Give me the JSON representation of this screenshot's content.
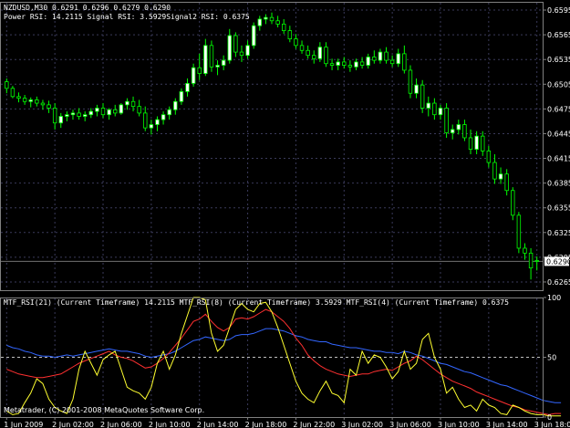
{
  "chart_data": [
    {
      "type": "candlestick",
      "symbol_line": "NZDUSD,M30  0.6291 0.6296 0.6279 0.6290",
      "indicator_line": "Power RSI: 14.2115 Signal RSI: 3.5929Signal2 RSI: 0.6375",
      "last_price_label": "0.6290",
      "last_price": 0.629,
      "ylim": [
        0.6255,
        0.6605
      ],
      "y_ticks": [
        "0.6595",
        "0.6565",
        "0.6535",
        "0.6505",
        "0.6475",
        "0.6445",
        "0.6415",
        "0.6385",
        "0.6355",
        "0.6325",
        "0.6295",
        "0.6265"
      ],
      "grid": true,
      "colors": {
        "bull": "#ffffff",
        "bear": "#000000",
        "wick": "#00ff00",
        "grid": "#3a3a5a",
        "last_price_line": "#707070"
      },
      "candles": [
        {
          "o": 0.6508,
          "h": 0.6512,
          "l": 0.6494,
          "c": 0.65
        },
        {
          "o": 0.65,
          "h": 0.6503,
          "l": 0.6488,
          "c": 0.649
        },
        {
          "o": 0.649,
          "h": 0.6495,
          "l": 0.6483,
          "c": 0.6488
        },
        {
          "o": 0.6488,
          "h": 0.6492,
          "l": 0.648,
          "c": 0.6484
        },
        {
          "o": 0.6484,
          "h": 0.6489,
          "l": 0.6477,
          "c": 0.6486
        },
        {
          "o": 0.6486,
          "h": 0.649,
          "l": 0.6478,
          "c": 0.6482
        },
        {
          "o": 0.6482,
          "h": 0.6486,
          "l": 0.6474,
          "c": 0.648
        },
        {
          "o": 0.648,
          "h": 0.6485,
          "l": 0.647,
          "c": 0.6476
        },
        {
          "o": 0.6476,
          "h": 0.6482,
          "l": 0.645,
          "c": 0.6458
        },
        {
          "o": 0.6458,
          "h": 0.647,
          "l": 0.6452,
          "c": 0.6466
        },
        {
          "o": 0.6466,
          "h": 0.6472,
          "l": 0.646,
          "c": 0.6468
        },
        {
          "o": 0.6468,
          "h": 0.6474,
          "l": 0.6462,
          "c": 0.647
        },
        {
          "o": 0.647,
          "h": 0.6476,
          "l": 0.6462,
          "c": 0.6466
        },
        {
          "o": 0.6466,
          "h": 0.6472,
          "l": 0.646,
          "c": 0.6468
        },
        {
          "o": 0.6468,
          "h": 0.6476,
          "l": 0.6464,
          "c": 0.6472
        },
        {
          "o": 0.6472,
          "h": 0.648,
          "l": 0.6466,
          "c": 0.6476
        },
        {
          "o": 0.6476,
          "h": 0.6482,
          "l": 0.6464,
          "c": 0.6468
        },
        {
          "o": 0.6468,
          "h": 0.6476,
          "l": 0.6462,
          "c": 0.6474
        },
        {
          "o": 0.6474,
          "h": 0.648,
          "l": 0.6466,
          "c": 0.647
        },
        {
          "o": 0.647,
          "h": 0.6482,
          "l": 0.6468,
          "c": 0.648
        },
        {
          "o": 0.648,
          "h": 0.6488,
          "l": 0.6474,
          "c": 0.6484
        },
        {
          "o": 0.6484,
          "h": 0.649,
          "l": 0.6472,
          "c": 0.6478
        },
        {
          "o": 0.6478,
          "h": 0.6486,
          "l": 0.6466,
          "c": 0.647
        },
        {
          "o": 0.647,
          "h": 0.6478,
          "l": 0.6448,
          "c": 0.6452
        },
        {
          "o": 0.6452,
          "h": 0.6462,
          "l": 0.6444,
          "c": 0.6456
        },
        {
          "o": 0.6456,
          "h": 0.6466,
          "l": 0.6448,
          "c": 0.6462
        },
        {
          "o": 0.6462,
          "h": 0.6472,
          "l": 0.6456,
          "c": 0.6468
        },
        {
          "o": 0.6468,
          "h": 0.6478,
          "l": 0.6462,
          "c": 0.6474
        },
        {
          "o": 0.6474,
          "h": 0.6488,
          "l": 0.6468,
          "c": 0.6484
        },
        {
          "o": 0.6484,
          "h": 0.65,
          "l": 0.648,
          "c": 0.6496
        },
        {
          "o": 0.6496,
          "h": 0.6512,
          "l": 0.649,
          "c": 0.6506
        },
        {
          "o": 0.6506,
          "h": 0.653,
          "l": 0.6502,
          "c": 0.6525
        },
        {
          "o": 0.6525,
          "h": 0.6542,
          "l": 0.651,
          "c": 0.6518
        },
        {
          "o": 0.6518,
          "h": 0.656,
          "l": 0.6515,
          "c": 0.6552
        },
        {
          "o": 0.6552,
          "h": 0.6558,
          "l": 0.652,
          "c": 0.6526
        },
        {
          "o": 0.6526,
          "h": 0.6534,
          "l": 0.6516,
          "c": 0.6528
        },
        {
          "o": 0.6528,
          "h": 0.654,
          "l": 0.6522,
          "c": 0.6534
        },
        {
          "o": 0.6534,
          "h": 0.6572,
          "l": 0.653,
          "c": 0.6564
        },
        {
          "o": 0.6564,
          "h": 0.6568,
          "l": 0.6538,
          "c": 0.6544
        },
        {
          "o": 0.6544,
          "h": 0.6552,
          "l": 0.6532,
          "c": 0.654
        },
        {
          "o": 0.654,
          "h": 0.6558,
          "l": 0.6536,
          "c": 0.6552
        },
        {
          "o": 0.6552,
          "h": 0.658,
          "l": 0.6548,
          "c": 0.6576
        },
        {
          "o": 0.6576,
          "h": 0.6588,
          "l": 0.657,
          "c": 0.6584
        },
        {
          "o": 0.6584,
          "h": 0.659,
          "l": 0.6578,
          "c": 0.6586
        },
        {
          "o": 0.6586,
          "h": 0.6592,
          "l": 0.6578,
          "c": 0.6582
        },
        {
          "o": 0.6582,
          "h": 0.6588,
          "l": 0.6574,
          "c": 0.6578
        },
        {
          "o": 0.6578,
          "h": 0.6584,
          "l": 0.6566,
          "c": 0.657
        },
        {
          "o": 0.657,
          "h": 0.6576,
          "l": 0.6556,
          "c": 0.656
        },
        {
          "o": 0.656,
          "h": 0.6566,
          "l": 0.6548,
          "c": 0.6552
        },
        {
          "o": 0.6552,
          "h": 0.6558,
          "l": 0.6542,
          "c": 0.6546
        },
        {
          "o": 0.6546,
          "h": 0.6552,
          "l": 0.6536,
          "c": 0.654
        },
        {
          "o": 0.654,
          "h": 0.6546,
          "l": 0.653,
          "c": 0.6536
        },
        {
          "o": 0.6536,
          "h": 0.6556,
          "l": 0.6532,
          "c": 0.655
        },
        {
          "o": 0.655,
          "h": 0.6556,
          "l": 0.6526,
          "c": 0.653
        },
        {
          "o": 0.653,
          "h": 0.6536,
          "l": 0.6522,
          "c": 0.6528
        },
        {
          "o": 0.6528,
          "h": 0.6536,
          "l": 0.6522,
          "c": 0.6532
        },
        {
          "o": 0.6532,
          "h": 0.6538,
          "l": 0.6524,
          "c": 0.6528
        },
        {
          "o": 0.6528,
          "h": 0.6534,
          "l": 0.652,
          "c": 0.6526
        },
        {
          "o": 0.6526,
          "h": 0.6536,
          "l": 0.6522,
          "c": 0.6532
        },
        {
          "o": 0.6532,
          "h": 0.6538,
          "l": 0.6524,
          "c": 0.6528
        },
        {
          "o": 0.6528,
          "h": 0.6542,
          "l": 0.6524,
          "c": 0.6538
        },
        {
          "o": 0.6538,
          "h": 0.6546,
          "l": 0.653,
          "c": 0.6534
        },
        {
          "o": 0.6534,
          "h": 0.6548,
          "l": 0.653,
          "c": 0.6544
        },
        {
          "o": 0.6544,
          "h": 0.655,
          "l": 0.653,
          "c": 0.6534
        },
        {
          "o": 0.6534,
          "h": 0.654,
          "l": 0.6526,
          "c": 0.653
        },
        {
          "o": 0.653,
          "h": 0.6548,
          "l": 0.6526,
          "c": 0.6542
        },
        {
          "o": 0.6542,
          "h": 0.6552,
          "l": 0.6518,
          "c": 0.6522
        },
        {
          "o": 0.6522,
          "h": 0.6528,
          "l": 0.6488,
          "c": 0.6494
        },
        {
          "o": 0.6494,
          "h": 0.6512,
          "l": 0.6488,
          "c": 0.6504
        },
        {
          "o": 0.6504,
          "h": 0.651,
          "l": 0.647,
          "c": 0.6476
        },
        {
          "o": 0.6476,
          "h": 0.649,
          "l": 0.6466,
          "c": 0.6482
        },
        {
          "o": 0.6482,
          "h": 0.6488,
          "l": 0.6462,
          "c": 0.6468
        },
        {
          "o": 0.6468,
          "h": 0.648,
          "l": 0.6462,
          "c": 0.6476
        },
        {
          "o": 0.6476,
          "h": 0.6482,
          "l": 0.644,
          "c": 0.6446
        },
        {
          "o": 0.6446,
          "h": 0.6456,
          "l": 0.6438,
          "c": 0.645
        },
        {
          "o": 0.645,
          "h": 0.6462,
          "l": 0.6444,
          "c": 0.6456
        },
        {
          "o": 0.6456,
          "h": 0.6462,
          "l": 0.6436,
          "c": 0.644
        },
        {
          "o": 0.644,
          "h": 0.645,
          "l": 0.642,
          "c": 0.6426
        },
        {
          "o": 0.6426,
          "h": 0.6448,
          "l": 0.642,
          "c": 0.6442
        },
        {
          "o": 0.6442,
          "h": 0.6448,
          "l": 0.6418,
          "c": 0.6424
        },
        {
          "o": 0.6424,
          "h": 0.643,
          "l": 0.6404,
          "c": 0.641
        },
        {
          "o": 0.641,
          "h": 0.642,
          "l": 0.6384,
          "c": 0.639
        },
        {
          "o": 0.639,
          "h": 0.6404,
          "l": 0.6384,
          "c": 0.6396
        },
        {
          "o": 0.6396,
          "h": 0.6402,
          "l": 0.637,
          "c": 0.6376
        },
        {
          "o": 0.6376,
          "h": 0.638,
          "l": 0.634,
          "c": 0.6346
        },
        {
          "o": 0.6346,
          "h": 0.635,
          "l": 0.63,
          "c": 0.6306
        },
        {
          "o": 0.6306,
          "h": 0.6312,
          "l": 0.6292,
          "c": 0.63
        },
        {
          "o": 0.63,
          "h": 0.6306,
          "l": 0.6268,
          "c": 0.6282
        },
        {
          "o": 0.6291,
          "h": 0.6296,
          "l": 0.6279,
          "c": 0.629
        }
      ]
    },
    {
      "type": "line",
      "title": "MTF_RSI(21) (Current Timeframe) 14.2115  MTF_RSI(8) (Current Timeframe) 3.5929  MTF_RSI(4) (Current Timeframe) 0.6375",
      "ylim": [
        0,
        100
      ],
      "y_ticks": [
        "100",
        "50",
        "0"
      ],
      "level": 50,
      "copyright": "Metatrader, (C) 2001-2008 MetaQuotes Software Corp.",
      "series": [
        {
          "color": "#3366ff",
          "values": [
            60,
            58,
            57,
            55,
            54,
            52,
            51,
            51,
            50,
            51,
            52,
            51,
            52,
            53,
            54,
            55,
            56,
            57,
            56,
            55,
            55,
            54,
            53,
            51,
            50,
            51,
            52,
            53,
            55,
            58,
            61,
            64,
            65,
            67,
            66,
            65,
            64,
            65,
            68,
            69,
            69,
            70,
            72,
            74,
            74,
            73,
            72,
            70,
            68,
            67,
            65,
            64,
            63,
            63,
            61,
            60,
            59,
            58,
            58,
            57,
            56,
            55,
            55,
            54,
            54,
            53,
            55,
            54,
            52,
            51,
            49,
            47,
            45,
            44,
            42,
            40,
            38,
            37,
            35,
            33,
            31,
            29,
            27,
            26,
            24,
            22,
            20,
            18,
            16,
            14,
            13,
            12,
            12
          ]
        },
        {
          "color": "#ff3030",
          "values": [
            40,
            38,
            36,
            35,
            34,
            33,
            33,
            34,
            35,
            36,
            39,
            42,
            45,
            47,
            49,
            51,
            53,
            55,
            52,
            50,
            49,
            47,
            44,
            41,
            42,
            45,
            49,
            54,
            60,
            66,
            73,
            80,
            82,
            86,
            80,
            75,
            72,
            75,
            82,
            83,
            82,
            84,
            87,
            90,
            88,
            84,
            80,
            74,
            66,
            60,
            52,
            47,
            43,
            40,
            38,
            36,
            35,
            34,
            35,
            36,
            36,
            38,
            39,
            40,
            39,
            42,
            45,
            47,
            51,
            48,
            44,
            40,
            36,
            33,
            30,
            28,
            26,
            24,
            21,
            19,
            17,
            15,
            13,
            11,
            9,
            8,
            6,
            5,
            4,
            3,
            2,
            3,
            3
          ]
        },
        {
          "color": "#ffff30",
          "values": [
            5,
            2,
            3,
            12,
            20,
            32,
            28,
            15,
            8,
            5,
            3,
            15,
            40,
            55,
            45,
            35,
            48,
            52,
            55,
            40,
            25,
            22,
            20,
            15,
            25,
            45,
            55,
            40,
            52,
            70,
            85,
            100,
            100,
            98,
            70,
            55,
            60,
            75,
            90,
            95,
            90,
            88,
            95,
            96,
            88,
            75,
            60,
            45,
            30,
            20,
            15,
            12,
            22,
            30,
            20,
            18,
            12,
            40,
            35,
            55,
            45,
            52,
            50,
            42,
            32,
            38,
            55,
            40,
            45,
            65,
            70,
            50,
            40,
            20,
            25,
            15,
            8,
            10,
            5,
            15,
            10,
            8,
            3,
            2,
            10,
            8,
            5,
            3,
            2,
            2,
            1,
            1,
            1
          ]
        }
      ]
    }
  ],
  "x_axis": {
    "tick_labels": [
      "1 Jun 2009",
      "2 Jun 02:00",
      "2 Jun 06:00",
      "2 Jun 10:00",
      "2 Jun 14:00",
      "2 Jun 18:00",
      "2 Jun 22:00",
      "3 Jun 02:00",
      "3 Jun 06:00",
      "3 Jun 10:00",
      "3 Jun 14:00",
      "3 Jun 18:00"
    ],
    "tick_indices": [
      0,
      8,
      16,
      24,
      32,
      40,
      48,
      56,
      64,
      72,
      80,
      88
    ]
  }
}
